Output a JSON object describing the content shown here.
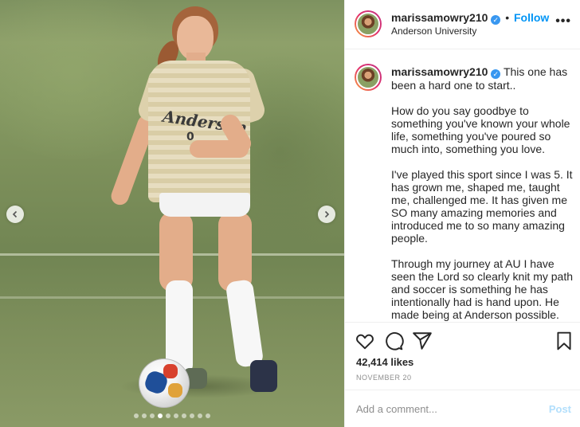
{
  "post": {
    "username": "marissamowry210",
    "verified": true,
    "follow_separator": "•",
    "follow_label": "Follow",
    "location": "Anderson University",
    "more_options": "•••",
    "jersey_text": "Anderson",
    "jersey_number": "0",
    "carousel": {
      "dot_count": 10,
      "active_index": 3
    }
  },
  "caption": {
    "username": "marissamowry210",
    "paragraphs": [
      "This one has been a hard one to start..",
      "How do you say goodbye to something you've known your whole life, something you've poured so much into, something you love.",
      "I've played this sport since I was 5. It has grown me, shaped me, taught me, challenged me. It has given me SO many amazing memories and introduced me to so many amazing people.",
      "Through my journey at AU I have seen the Lord so clearly knit my path and soccer is something he has intentionally had is hand upon. He made being at Anderson possible. He"
    ]
  },
  "engagement": {
    "likes": "42,414 likes",
    "date": "NOVEMBER 20"
  },
  "comment_box": {
    "placeholder": "Add a comment...",
    "post_label": "Post"
  },
  "icons": {
    "prev": "chevron-left-icon",
    "next": "chevron-right-icon",
    "like": "heart-icon",
    "comment": "comment-icon",
    "share": "share-icon",
    "save": "bookmark-icon"
  },
  "colors": {
    "follow": "#0095f6",
    "verified": "#3897f0",
    "post_disabled": "#b2dffc",
    "muted": "#8e8e8e"
  }
}
